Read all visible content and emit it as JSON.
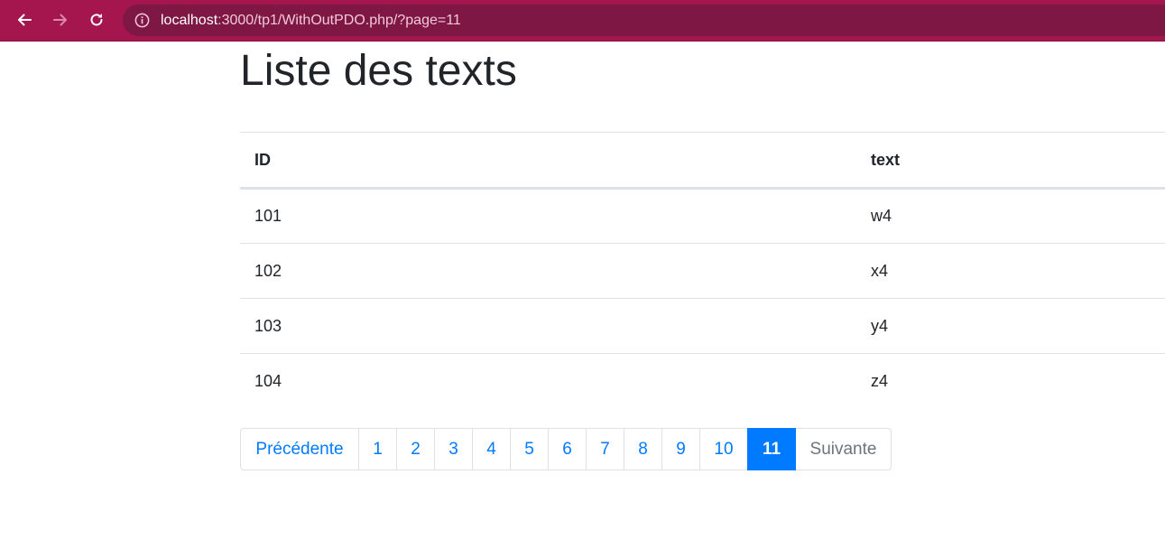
{
  "browser": {
    "url_host": "localhost",
    "url_path": ":3000/tp1/WithOutPDO.php/?page=11"
  },
  "page": {
    "title": "Liste des texts"
  },
  "table": {
    "headers": {
      "id": "ID",
      "text": "text"
    },
    "rows": [
      {
        "id": "101",
        "text": "w4"
      },
      {
        "id": "102",
        "text": "x4"
      },
      {
        "id": "103",
        "text": "y4"
      },
      {
        "id": "104",
        "text": "z4"
      }
    ]
  },
  "pagination": {
    "prev_label": "Précédente",
    "next_label": "Suivante",
    "pages": [
      "1",
      "2",
      "3",
      "4",
      "5",
      "6",
      "7",
      "8",
      "9",
      "10",
      "11"
    ],
    "current": "11"
  },
  "colors": {
    "toolbar": "#a5154e",
    "urlbar": "#7e1744",
    "link": "#007bff",
    "active": "#007bff"
  }
}
